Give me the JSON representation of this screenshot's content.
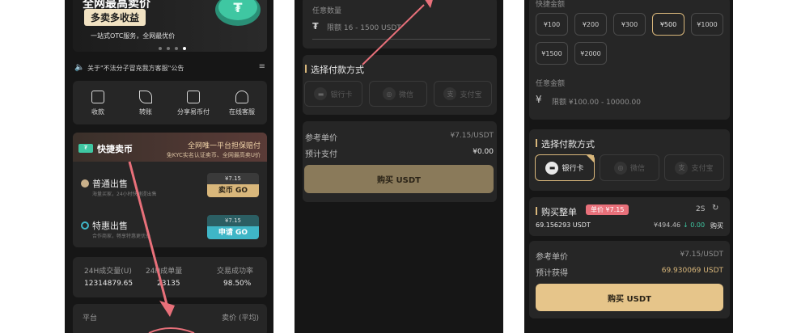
{
  "left": {
    "banner_title_partial": "全网最高卖价",
    "banner_highlight": "多卖多收益",
    "banner_sub": "一站式OTC服务，全网最优价",
    "notice": "关于\"不法分子冒充我方客服\"公告",
    "actions": [
      {
        "label": "收款",
        "icon": "qr-code-icon"
      },
      {
        "label": "转账",
        "icon": "send-icon"
      },
      {
        "label": "分享易币付",
        "icon": "share-icon"
      },
      {
        "label": "在线客服",
        "icon": "headset-icon"
      }
    ],
    "quick_sell": {
      "title": "快捷卖币",
      "slogan_1": "全网唯一平台担保赔付",
      "slogan_2": "免KYC实名认证卖币、全网最高卖U价"
    },
    "normal_sell": {
      "title": "普通出售",
      "desc": "海量买家，24小时快速提出售",
      "price": "¥7.15",
      "button": "卖币 GO"
    },
    "special_sell": {
      "title": "特惠出售",
      "desc": "合作商家，畅享特惠更优价",
      "price": "¥7.15",
      "button": "申请 GO"
    },
    "stats": [
      {
        "label": "24H成交量(U)",
        "value": "12314879.65"
      },
      {
        "label": "24H成单量",
        "value": "23135"
      },
      {
        "label": "交易成功率",
        "value": "98.50%"
      }
    ],
    "platform_header": "平台",
    "price_header": "卖价 (平均)"
  },
  "middle": {
    "qty_label": "任意数量",
    "qty_placeholder": "限额 16 - 1500 USDT",
    "payment_title": "选择付款方式",
    "methods": [
      {
        "label": "银行卡",
        "icon": "bank-card-icon"
      },
      {
        "label": "微信",
        "icon": "wechat-icon"
      },
      {
        "label": "支付宝",
        "icon": "alipay-icon"
      }
    ],
    "ref_price_label": "参考单价",
    "ref_price_value": "¥7.15/USDT",
    "est_pay_label": "预计支付",
    "est_pay_value": "¥0.00",
    "buy_button": "购买 USDT"
  },
  "right": {
    "quick_amount_label": "快捷金额",
    "amounts": [
      "¥100",
      "¥200",
      "¥300",
      "¥500",
      "¥1000",
      "¥1500",
      "¥2000"
    ],
    "selected_amount": "¥500",
    "any_amount_label": "任意金额",
    "amount_placeholder": "限额 ¥100.00 - 10000.00",
    "payment_title": "选择付款方式",
    "methods": [
      {
        "label": "银行卡",
        "icon": "bank-card-icon"
      },
      {
        "label": "微信",
        "icon": "wechat-icon"
      },
      {
        "label": "支付宝",
        "icon": "alipay-icon"
      }
    ],
    "whole_order_title": "购买整单",
    "unit_price_badge": "单价 ¥7.15",
    "countdown": "2S",
    "order_amount": "69.156293 USDT",
    "order_price": "¥494.46",
    "order_change": "↓ 0.00",
    "order_buy": "购买",
    "ref_price_label": "参考单价",
    "ref_price_value": "¥7.15/USDT",
    "est_get_label": "预计获得",
    "est_get_value": "69.930069 USDT",
    "buy_button": "购买 USDT"
  }
}
